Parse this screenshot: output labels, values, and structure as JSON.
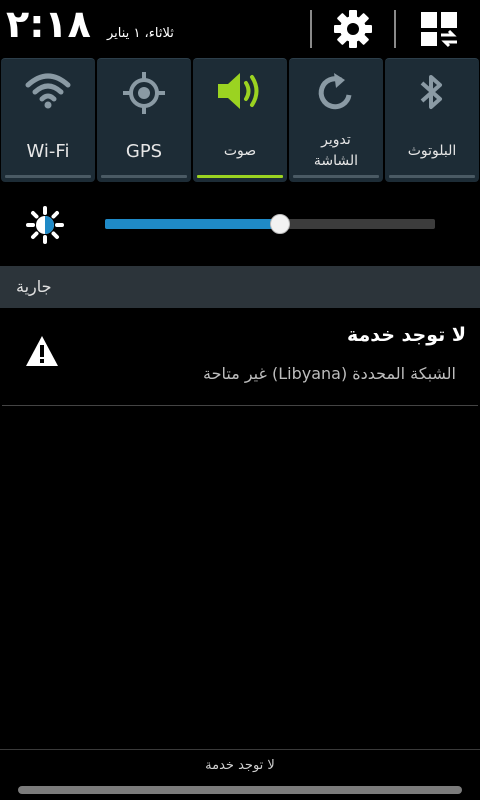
{
  "header": {
    "time": "٢:١٨",
    "date": "ثلاثاء، ١ يناير",
    "settings_icon": "gear-icon",
    "panel_icon": "grid-toggle-icon"
  },
  "quick_settings": [
    {
      "label": "Wi-Fi",
      "icon": "wifi-icon",
      "active": false
    },
    {
      "label": "GPS",
      "icon": "gps-icon",
      "active": false
    },
    {
      "label": "صوت",
      "icon": "speaker-icon",
      "active": true
    },
    {
      "label": "تدوير\nالشاشة",
      "icon": "rotate-icon",
      "active": false
    },
    {
      "label": "البلوتوث",
      "icon": "bluetooth-icon",
      "active": false
    }
  ],
  "brightness": {
    "icon": "brightness-icon",
    "level": 0.53
  },
  "section": {
    "title": "جارية"
  },
  "notification": {
    "icon": "warning-icon",
    "title": "لا توجد خدمة",
    "subtitle": "الشبكة المحددة (Libyana) غير متاحة"
  },
  "footer": {
    "carrier_text": "لا توجد خدمة"
  },
  "colors": {
    "accent": "#9bd321",
    "slider": "#1f8ac7",
    "tile": "#1d2c36"
  }
}
